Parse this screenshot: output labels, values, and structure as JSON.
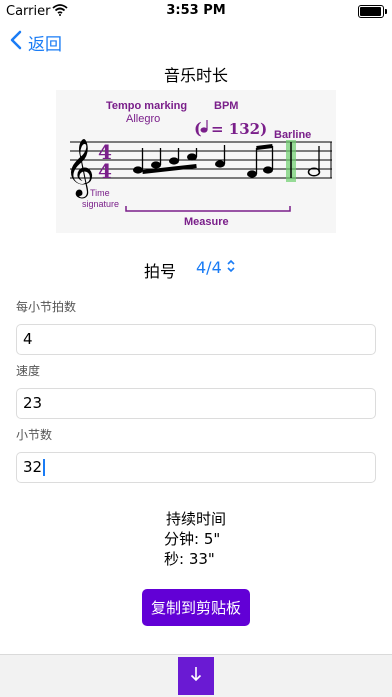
{
  "status_bar": {
    "carrier": "Carrier",
    "time": "3:53 PM",
    "battery_level": 1.0
  },
  "nav": {
    "back_label": "返回"
  },
  "page_title": "音乐时长",
  "diagram": {
    "tempo_marking": "Tempo marking",
    "tempo_value": "Allegro",
    "bpm_label": "BPM",
    "bpm_value": "= 132)",
    "bpm_open": "(",
    "barline_label": "Barline",
    "time_signature_label": "Time",
    "time_signature_label2": "signature",
    "measure_label": "Measure",
    "time_sig_top": "4",
    "time_sig_bottom": "4"
  },
  "time_signature": {
    "label": "拍号",
    "selected": "4/4"
  },
  "fields": {
    "beats_per_measure": {
      "label": "每小节拍数",
      "value": "4"
    },
    "tempo": {
      "label": "速度",
      "value": "23"
    },
    "measures": {
      "label": "小节数",
      "value": "32"
    }
  },
  "result": {
    "heading": "持续时间",
    "minutes": "分钟: 5\"",
    "seconds": "秒: 33\""
  },
  "copy_button": "复制到剪贴板",
  "colors": {
    "accent_blue": "#1a7cf5",
    "button_purple": "#6200d6",
    "diagram_purple": "#7a1f8a",
    "barline_green": "#6dd06d"
  }
}
